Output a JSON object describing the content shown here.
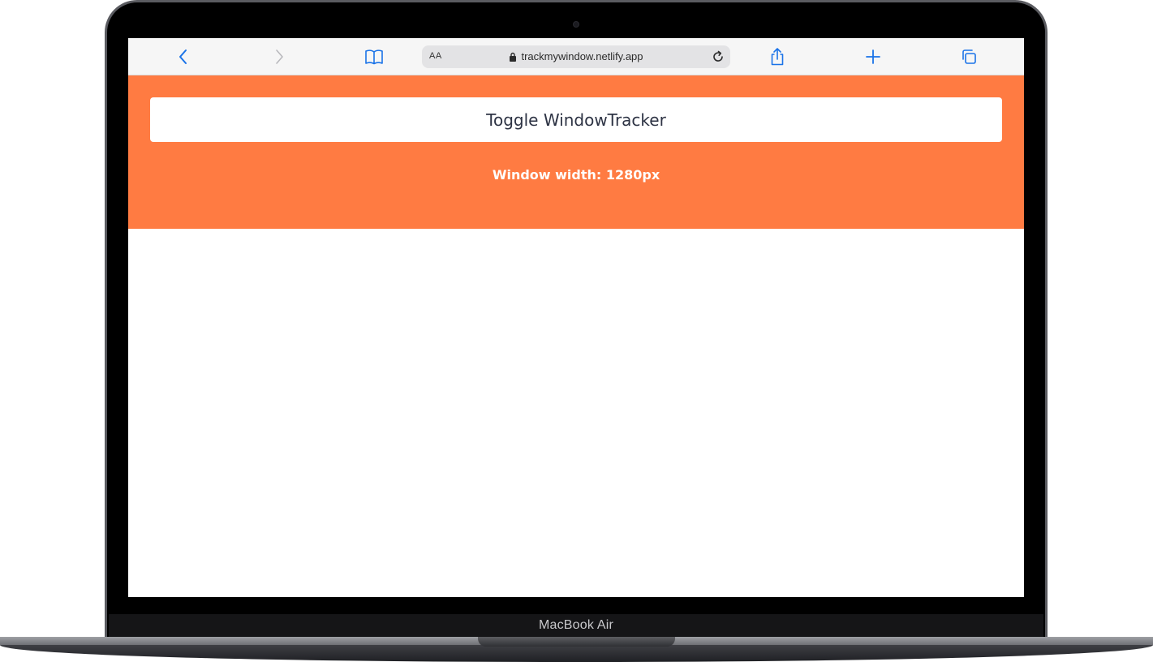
{
  "device": {
    "label": "MacBook Air"
  },
  "browser": {
    "url": "trackmywindow.netlify.app",
    "text_size_label": "AA",
    "accent_color": "#1a73e8"
  },
  "page": {
    "header_color": "#ff7b42",
    "toggle_button_label": "Toggle WindowTracker",
    "window_width_text": "Window width: 1280px"
  }
}
